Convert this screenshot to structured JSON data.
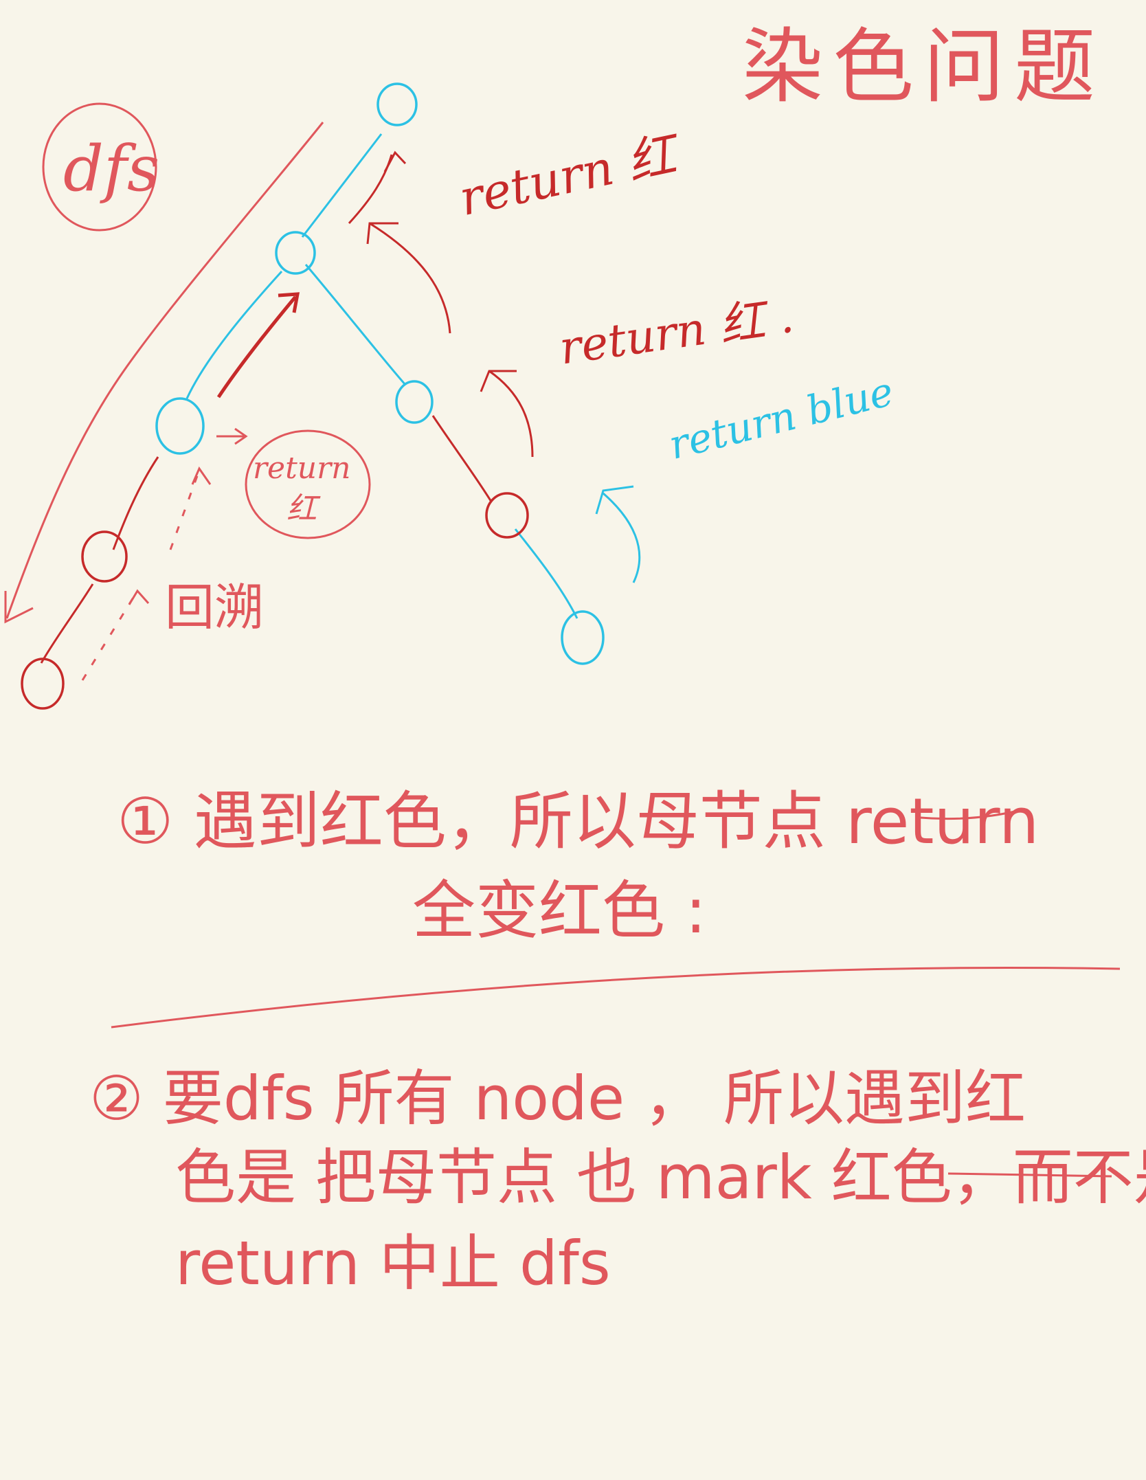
{
  "title": "染色问题",
  "labels": {
    "dfs": "dfs",
    "return_red_top": "return 红",
    "return_red_mid": "return 红 .",
    "return_blue": "return blue",
    "return_red_small_line1": "return",
    "return_red_small_line2": "红",
    "backtrack": "回溯"
  },
  "notes": {
    "note1_line1": "① 遇到红色，所以母节点 return",
    "note1_line2": "全变红色 :",
    "note2_line1": "② 要dfs 所有 node ， 所以遇到红",
    "note2_line2": "色是 把母节点 也 mark 红色，而不是",
    "note2_line3": "return 中止 dfs"
  },
  "colors": {
    "paper": "#f8f5ea",
    "red_ink": "#e0575c",
    "dark_red_ink": "#c62a2a",
    "blue_ink": "#2cc1e4"
  }
}
